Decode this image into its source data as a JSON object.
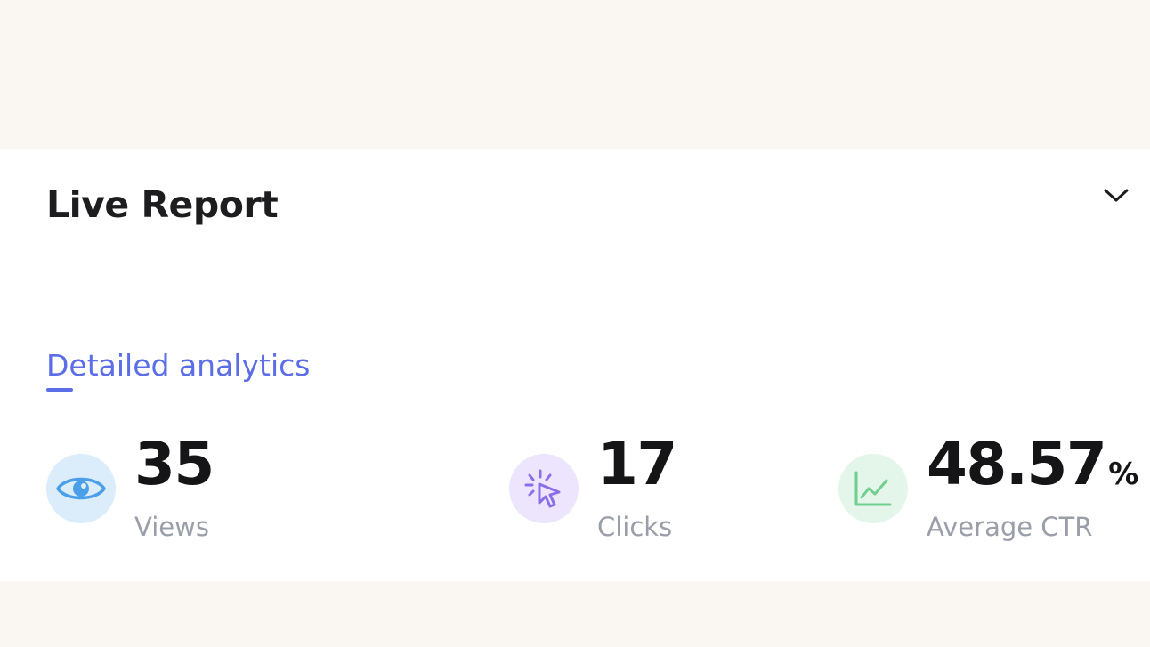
{
  "report": {
    "title": "Live Report",
    "collapse_icon": "chevron-down-icon",
    "tab_label": "Detailed analytics",
    "accent_color": "#5b6ee8"
  },
  "stats": {
    "views": {
      "value": "35",
      "label": "Views",
      "icon": "eye-icon",
      "icon_bg": "#dbecfb",
      "icon_color": "#4a9fe8"
    },
    "clicks": {
      "value": "17",
      "label": "Clicks",
      "icon": "cursor-click-icon",
      "icon_bg": "#ece5fd",
      "icon_color": "#8a6ee8"
    },
    "ctr": {
      "value": "48.57",
      "unit": "%",
      "label": "Average CTR",
      "icon": "line-chart-icon",
      "icon_bg": "#e3f6e9",
      "icon_color": "#6fcf8f"
    }
  }
}
